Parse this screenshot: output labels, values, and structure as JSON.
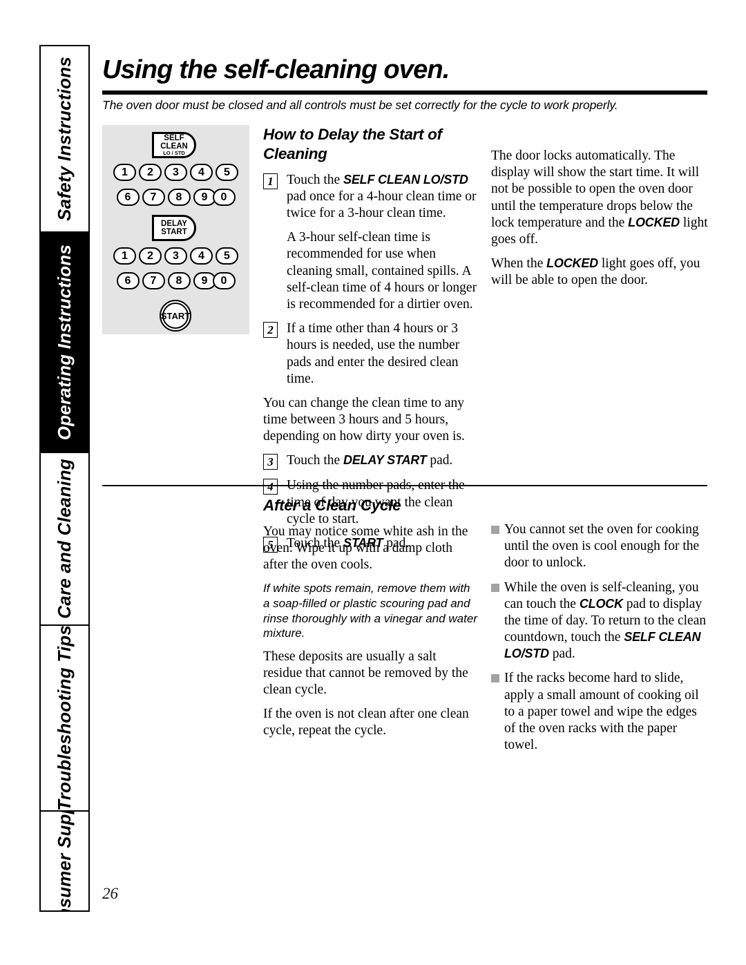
{
  "page": {
    "title": "Using the self-cleaning oven.",
    "lead": "The oven door must be closed and all controls must be set correctly for the cycle to work properly.",
    "number": "26"
  },
  "sidebar": {
    "tabs": [
      {
        "label": "Safety Instructions",
        "active": false
      },
      {
        "label": "Operating Instructions",
        "active": true
      },
      {
        "label": "Care and Cleaning",
        "active": false
      },
      {
        "label": "Troubleshooting Tips",
        "active": false
      },
      {
        "label": "Consumer Support",
        "active": false
      }
    ]
  },
  "control_panel": {
    "self_clean_pad": {
      "line1": "SELF",
      "line2": "CLEAN",
      "line3": "LO / STD"
    },
    "delay_start_pad": {
      "line1": "DELAY",
      "line2": "START"
    },
    "start_pad": "START",
    "number_row_1": [
      "1",
      "2",
      "3",
      "4",
      "5"
    ],
    "number_row_2": [
      "6",
      "7",
      "8",
      "9",
      "0"
    ],
    "number_row_3": [
      "1",
      "2",
      "3",
      "4",
      "5"
    ],
    "number_row_4": [
      "6",
      "7",
      "8",
      "9",
      "0"
    ],
    "background_color": "#e4e4e4"
  },
  "delay_section": {
    "heading": "How to Delay the Start of Cleaning",
    "step1_num": "1",
    "step1_pre": "Touch the ",
    "step1_pad": "SELF CLEAN LO/STD",
    "step1_post": " pad once for a 4-hour clean time or twice for a 3-hour clean time.",
    "step1_note": "A 3-hour self-clean time is recommended for use when cleaning small, contained spills. A self-clean time of 4 hours or longer is recommended for a dirtier oven.",
    "step2_num": "2",
    "step2_text": "If a time other than 4 hours or 3 hours is needed, use the number pads and enter the desired clean time.",
    "note_after_2": "You can change the clean time to any time between 3 hours and 5 hours, depending on how dirty your oven is.",
    "step3_num": "3",
    "step3_pre": "Touch the ",
    "step3_pad": "DELAY START",
    "step3_post": " pad.",
    "step4_num": "4",
    "step4_text": "Using the number pads, enter the time of day you want the clean cycle to start.",
    "step5_num": "5",
    "step5_pre": "Touch the ",
    "step5_pad": "START",
    "step5_post": " pad.",
    "right_p1_a": "The door locks automatically. The display will show the start time. It will not be possible to open the oven door until the temperature drops below the lock temperature and the ",
    "right_p1_pad": "LOCKED",
    "right_p1_b": " light goes off.",
    "right_p2_a": "When the ",
    "right_p2_pad": "LOCKED",
    "right_p2_b": " light goes off, you will be able to open the door."
  },
  "after_clean_section": {
    "heading": "After a Clean Cycle",
    "p1": "You may notice some white ash in the oven. Wipe it up with a damp cloth after the oven cools.",
    "p2_italic": "If white spots remain, remove them with a soap-filled or plastic scouring pad and rinse thoroughly with a vinegar and water mixture.",
    "p3": "These deposits are usually a salt residue that cannot be removed by the clean cycle.",
    "p4": "If the oven is not clean after one clean cycle, repeat the cycle.",
    "bullets": [
      {
        "text_a": "You cannot set the oven for cooking until the oven is cool enough for the door to unlock.",
        "pad": "",
        "text_b": ""
      },
      {
        "text_a": "While the oven is self-cleaning, you can touch the ",
        "pad": "CLOCK",
        "text_b": " pad to display the time of day. To return to the clean countdown, touch the ",
        "pad2": "SELF CLEAN LO/STD",
        "text_c": " pad."
      },
      {
        "text_a": "If the racks become hard to slide, apply a small amount of cooking oil to a paper towel and wipe the edges of the oven racks with the paper towel.",
        "pad": "",
        "text_b": ""
      }
    ]
  }
}
